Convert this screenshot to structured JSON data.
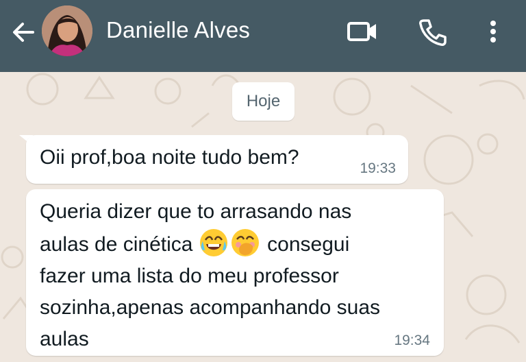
{
  "header": {
    "contact_name": "Danielle Alves",
    "back_icon": "arrow-left-icon",
    "video_icon": "video-call-icon",
    "call_icon": "phone-icon",
    "menu_icon": "more-vertical-icon",
    "bg_color": "#455a64"
  },
  "chat": {
    "date_label": "Hoje",
    "messages": [
      {
        "text": "Oii prof,boa noite tudo bem?",
        "time": "19:33"
      },
      {
        "text_part1": "Queria dizer que to arrasando nas\naulas de cinética ",
        "emoji_1": "😂",
        "emoji_2": "🤭",
        "text_part2": " consegui\nfazer uma lista do meu professor\nsozinha,apenas acompanhando suas\naulas",
        "time": "19:34"
      }
    ]
  }
}
